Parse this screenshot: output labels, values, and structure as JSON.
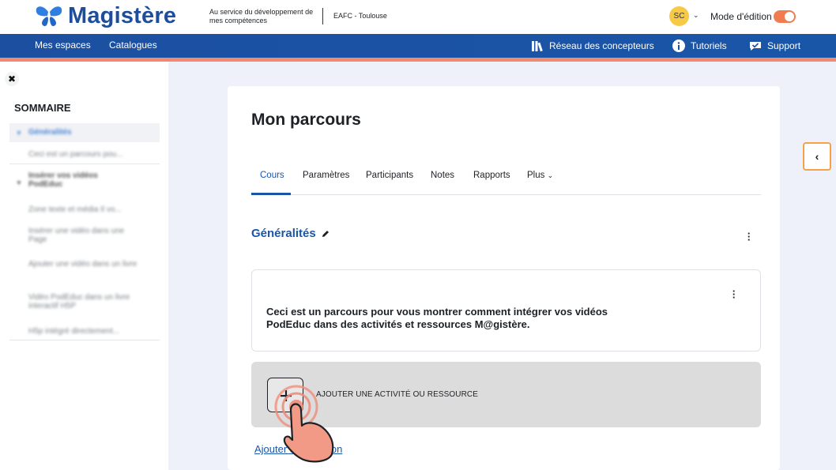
{
  "header": {
    "logo_text": "Magistère",
    "tagline": "Au service du développement de mes compétences",
    "org": "EAFC - Toulouse",
    "avatar_initials": "SC",
    "edit_mode_label": "Mode d'édition",
    "edit_mode_on": true
  },
  "nav": {
    "left": [
      "Mes espaces",
      "Catalogues"
    ],
    "right": [
      {
        "label": "Réseau des concepteurs",
        "icon": "books-icon"
      },
      {
        "label": "Tutoriels",
        "icon": "info-icon"
      },
      {
        "label": "Support",
        "icon": "support-icon"
      }
    ]
  },
  "sidebar": {
    "close_icon": "✖",
    "heading": "SOMMAIRE",
    "items": [
      {
        "label": "Généralités",
        "level": 0,
        "active": true
      },
      {
        "label": "Ceci est un parcours pou...",
        "level": 1
      },
      {
        "label": "Insérer vos vidéos PodEduc",
        "level": 0
      },
      {
        "label": "Zone texte et média Il vo...",
        "level": 1
      },
      {
        "label": "Insérer une vidéo dans une Page",
        "level": 1
      },
      {
        "label": "Ajouter une vidéo dans un livre",
        "level": 1
      },
      {
        "label": "Vidéo PodEduc dans un livre interactif H5P",
        "level": 1
      },
      {
        "label": "H5p intégré directement...",
        "level": 1
      }
    ]
  },
  "main": {
    "title": "Mon parcours",
    "tabs": [
      "Cours",
      "Paramètres",
      "Participants",
      "Notes",
      "Rapports",
      "Plus"
    ],
    "active_tab": "Cours",
    "section_title": "Généralités",
    "summary": "Ceci est un parcours pour vous montrer comment intégrer vos vidéos PodEduc dans des activités et ressources M@gistère.",
    "add_activity_label": "AJOUTER UNE ACTIVITÉ OU RESSOURCE",
    "add_section_label": "Ajouter une section"
  },
  "colors": {
    "brand_blue": "#1a56a8",
    "accent_orange": "#f07c50",
    "avatar_yellow": "#f7c948"
  }
}
